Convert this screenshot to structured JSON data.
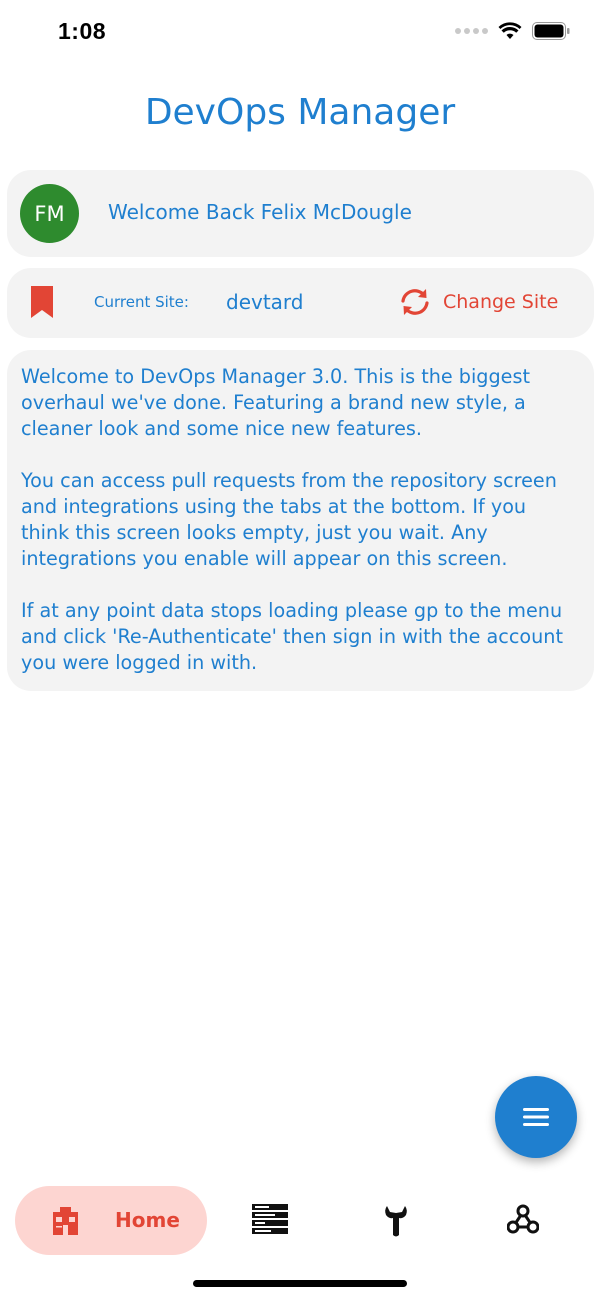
{
  "status_bar": {
    "time": "1:08"
  },
  "app": {
    "title": "DevOps Manager"
  },
  "welcome": {
    "avatar_initials": "FM",
    "message": "Welcome Back Felix McDougle"
  },
  "site": {
    "label": "Current Site:",
    "value": "devtard",
    "change_label": "Change Site"
  },
  "info": {
    "paragraphs": [
      "Welcome to DevOps Manager 3.0. This is the biggest overhaul we've done. Featuring a brand new style, a cleaner look and some nice new features.",
      "You can access pull requests from the repository screen and integrations using the tabs at the bottom. If you think this screen looks empty, just you wait. Any integrations you enable will appear on this screen.",
      "If at any point data stops loading please gp to the menu and click 'Re-Authenticate' then sign in with the account you were logged in with."
    ]
  },
  "fab": {
    "icon": "menu-icon"
  },
  "bottom_nav": {
    "items": [
      {
        "label": "Home",
        "icon": "home-icon",
        "active": true
      },
      {
        "icon": "repository-icon",
        "active": false
      },
      {
        "icon": "wrench-icon",
        "active": false
      },
      {
        "icon": "webhook-icon",
        "active": false
      }
    ]
  },
  "colors": {
    "primary": "#1f7fcf",
    "accent": "#e24535",
    "avatar": "#2e8b2e",
    "card": "#f3f3f3",
    "active_tab": "#fdd5d1"
  }
}
